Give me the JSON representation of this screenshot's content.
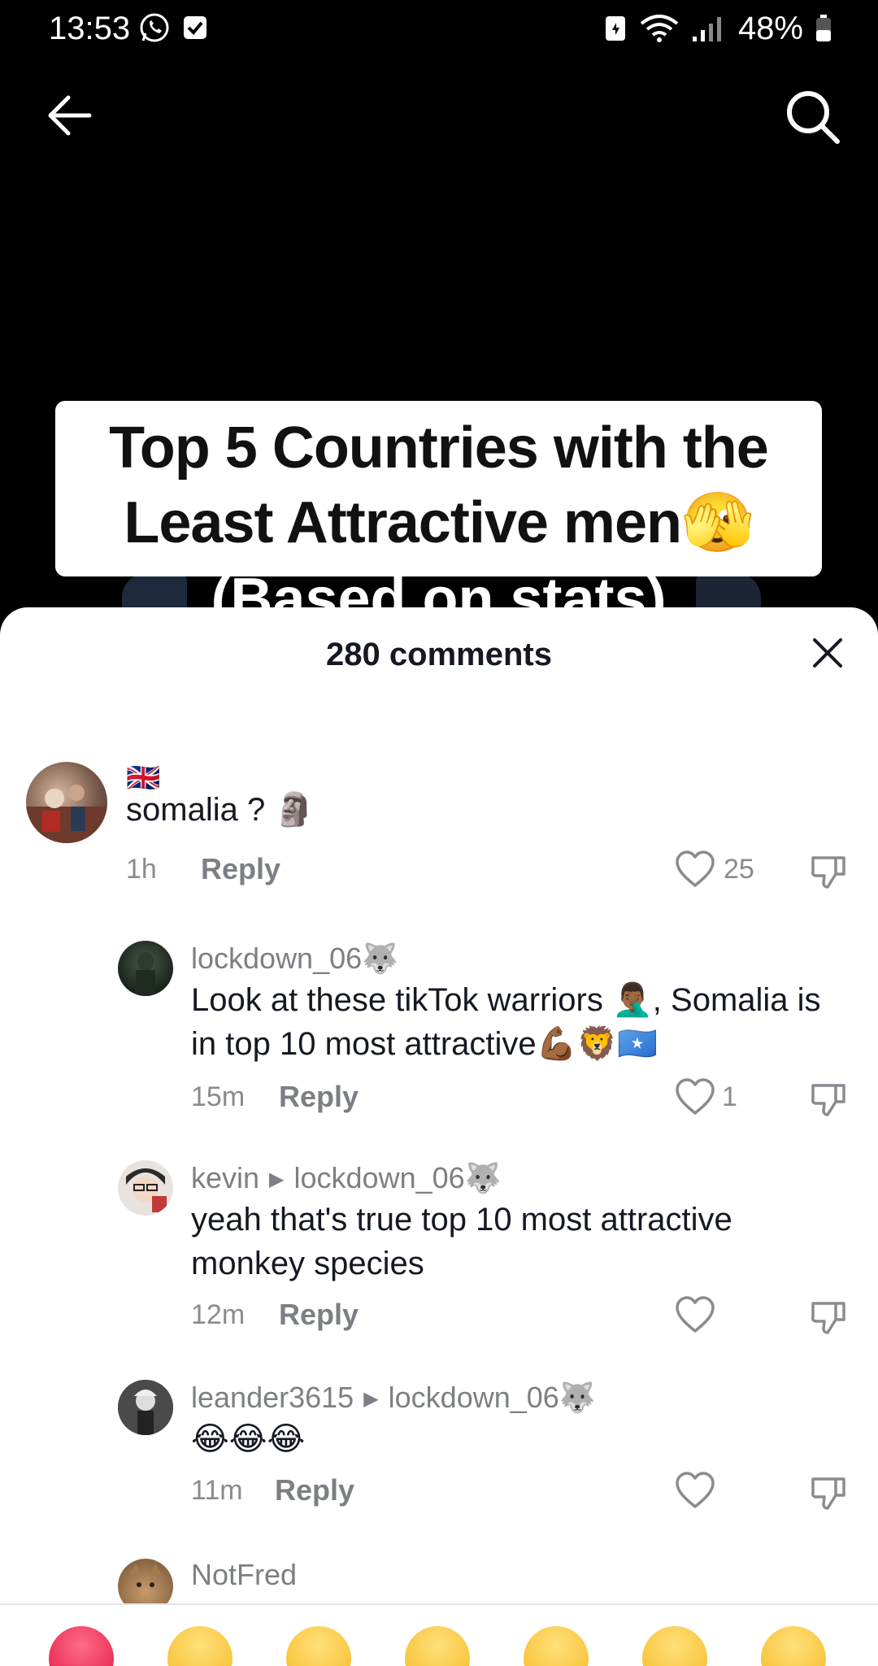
{
  "status_bar": {
    "time": "13:53",
    "battery": "48%",
    "icons": [
      "whatsapp-icon",
      "checkbox-notification-icon",
      "battery-saver-icon",
      "wifi-icon",
      "signal-icon",
      "battery-icon"
    ]
  },
  "nav": {
    "back_icon": "arrow-left-icon",
    "search_icon": "search-icon"
  },
  "video": {
    "title_line1": "Top 5 Countries with the",
    "title_line2": "Least Attractive men🫣",
    "title_line3": "(Based on stats)"
  },
  "comments_sheet": {
    "title": "280 comments",
    "close_icon": "close-icon",
    "comments": [
      {
        "username": "🇬🇧",
        "text": "somalia ? 🗿",
        "time": "1h",
        "reply_label": "Reply",
        "likes": "25"
      },
      {
        "username": "lockdown_06🐺",
        "text": "Look at these tikTok warriors 🤦🏾‍♂️, Somalia is in top 10 most attractive💪🏾🦁🇸🇴",
        "time": "15m",
        "reply_label": "Reply",
        "likes": "1"
      },
      {
        "username": "kevin",
        "reply_to": "lockdown_06🐺",
        "text": "yeah that's true top 10 most attractive monkey species",
        "time": "12m",
        "reply_label": "Reply",
        "likes": ""
      },
      {
        "username": "leander3615",
        "reply_to": "lockdown_06🐺",
        "text": "😂😂😂",
        "time": "11m",
        "reply_label": "Reply",
        "likes": ""
      },
      {
        "username": "NotFred"
      }
    ]
  },
  "emoji_bar": {
    "emojis": [
      "❤️",
      "😂",
      "😅",
      "😳",
      "🥰",
      "😊",
      "🥺"
    ]
  },
  "colors": {
    "sheet_bg": "#ffffff",
    "text_primary": "#161823",
    "text_secondary": "#7d7f86"
  }
}
